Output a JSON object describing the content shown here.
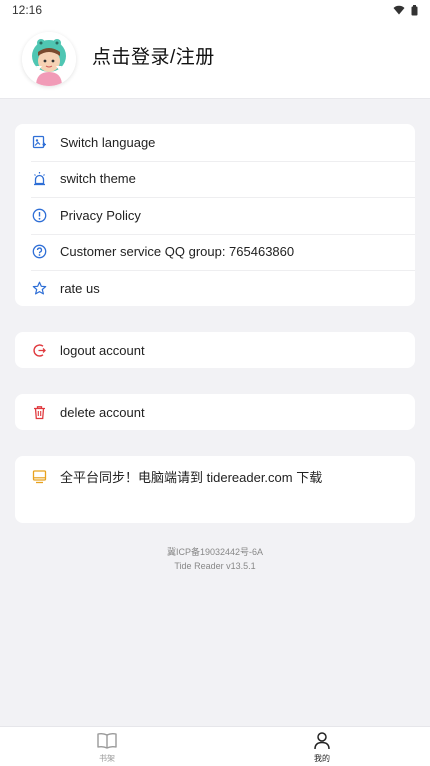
{
  "status_bar": {
    "time": "12:16"
  },
  "header": {
    "login_text": "点击登录/注册"
  },
  "menu": {
    "items": [
      {
        "label": "Switch language",
        "icon": "language-icon"
      },
      {
        "label": "switch theme",
        "icon": "theme-icon"
      },
      {
        "label": "Privacy Policy",
        "icon": "info-icon"
      },
      {
        "label": "Customer service QQ group: 765463860",
        "icon": "help-icon"
      },
      {
        "label": "rate us",
        "icon": "star-icon"
      }
    ]
  },
  "logout": {
    "label": "logout account",
    "icon": "logout-icon"
  },
  "delete": {
    "label": "delete account",
    "icon": "trash-icon"
  },
  "promo": {
    "label": "全平台同步！电脑端请到 tidereader.com 下载",
    "icon": "desktop-icon"
  },
  "footer": {
    "icp": "冀ICP备19032442号-6A",
    "version": "Tide Reader v13.5.1"
  },
  "tabs": [
    {
      "label": "书架",
      "icon": "book-icon",
      "active": false
    },
    {
      "label": "我的",
      "icon": "person-icon",
      "active": true
    }
  ],
  "colors": {
    "accent_blue": "#2f6fd6",
    "danger_red": "#e0393e",
    "promo_orange": "#e8a21e",
    "background": "#f2f2f5"
  }
}
